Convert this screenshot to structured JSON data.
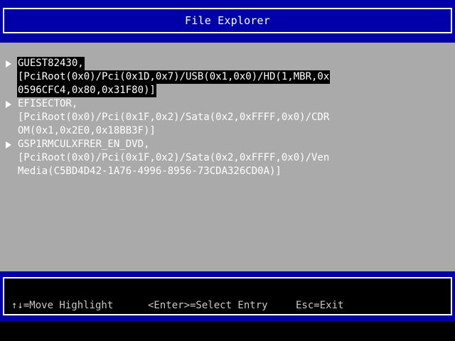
{
  "title": "File Explorer",
  "entries": [
    {
      "lines": [
        "GUEST82430,",
        "[PciRoot(0x0)/Pci(0x1D,0x7)/USB(0x1,0x0)/HD(1,MBR,0x",
        "0596CFC4,0x80,0x31F80)]"
      ],
      "selected": true
    },
    {
      "lines": [
        "EFISECTOR,",
        "[PciRoot(0x0)/Pci(0x1F,0x2)/Sata(0x2,0xFFFF,0x0)/CDR",
        "OM(0x1,0x2E0,0x18BB3F)]"
      ],
      "selected": false
    },
    {
      "lines": [
        "GSP1RMCULXFRER_EN_DVD,",
        "[PciRoot(0x0)/Pci(0x1F,0x2)/Sata(0x2,0xFFFF,0x0)/Ven",
        "Media(C5BD4D42-1A76-4996-8956-73CDA326CD0A)]"
      ],
      "selected": false
    }
  ],
  "footer": {
    "move_highlight": "↑↓=Move Highlight",
    "select_entry": "<Enter>=Select Entry",
    "exit": "Esc=Exit"
  },
  "colors": {
    "frame_blue": "#0000a8",
    "content_gray": "#aaaaaa",
    "text_white": "#ffffff",
    "highlight_black": "#000000"
  },
  "icons": {
    "entry_marker": "right-triangle-icon"
  }
}
